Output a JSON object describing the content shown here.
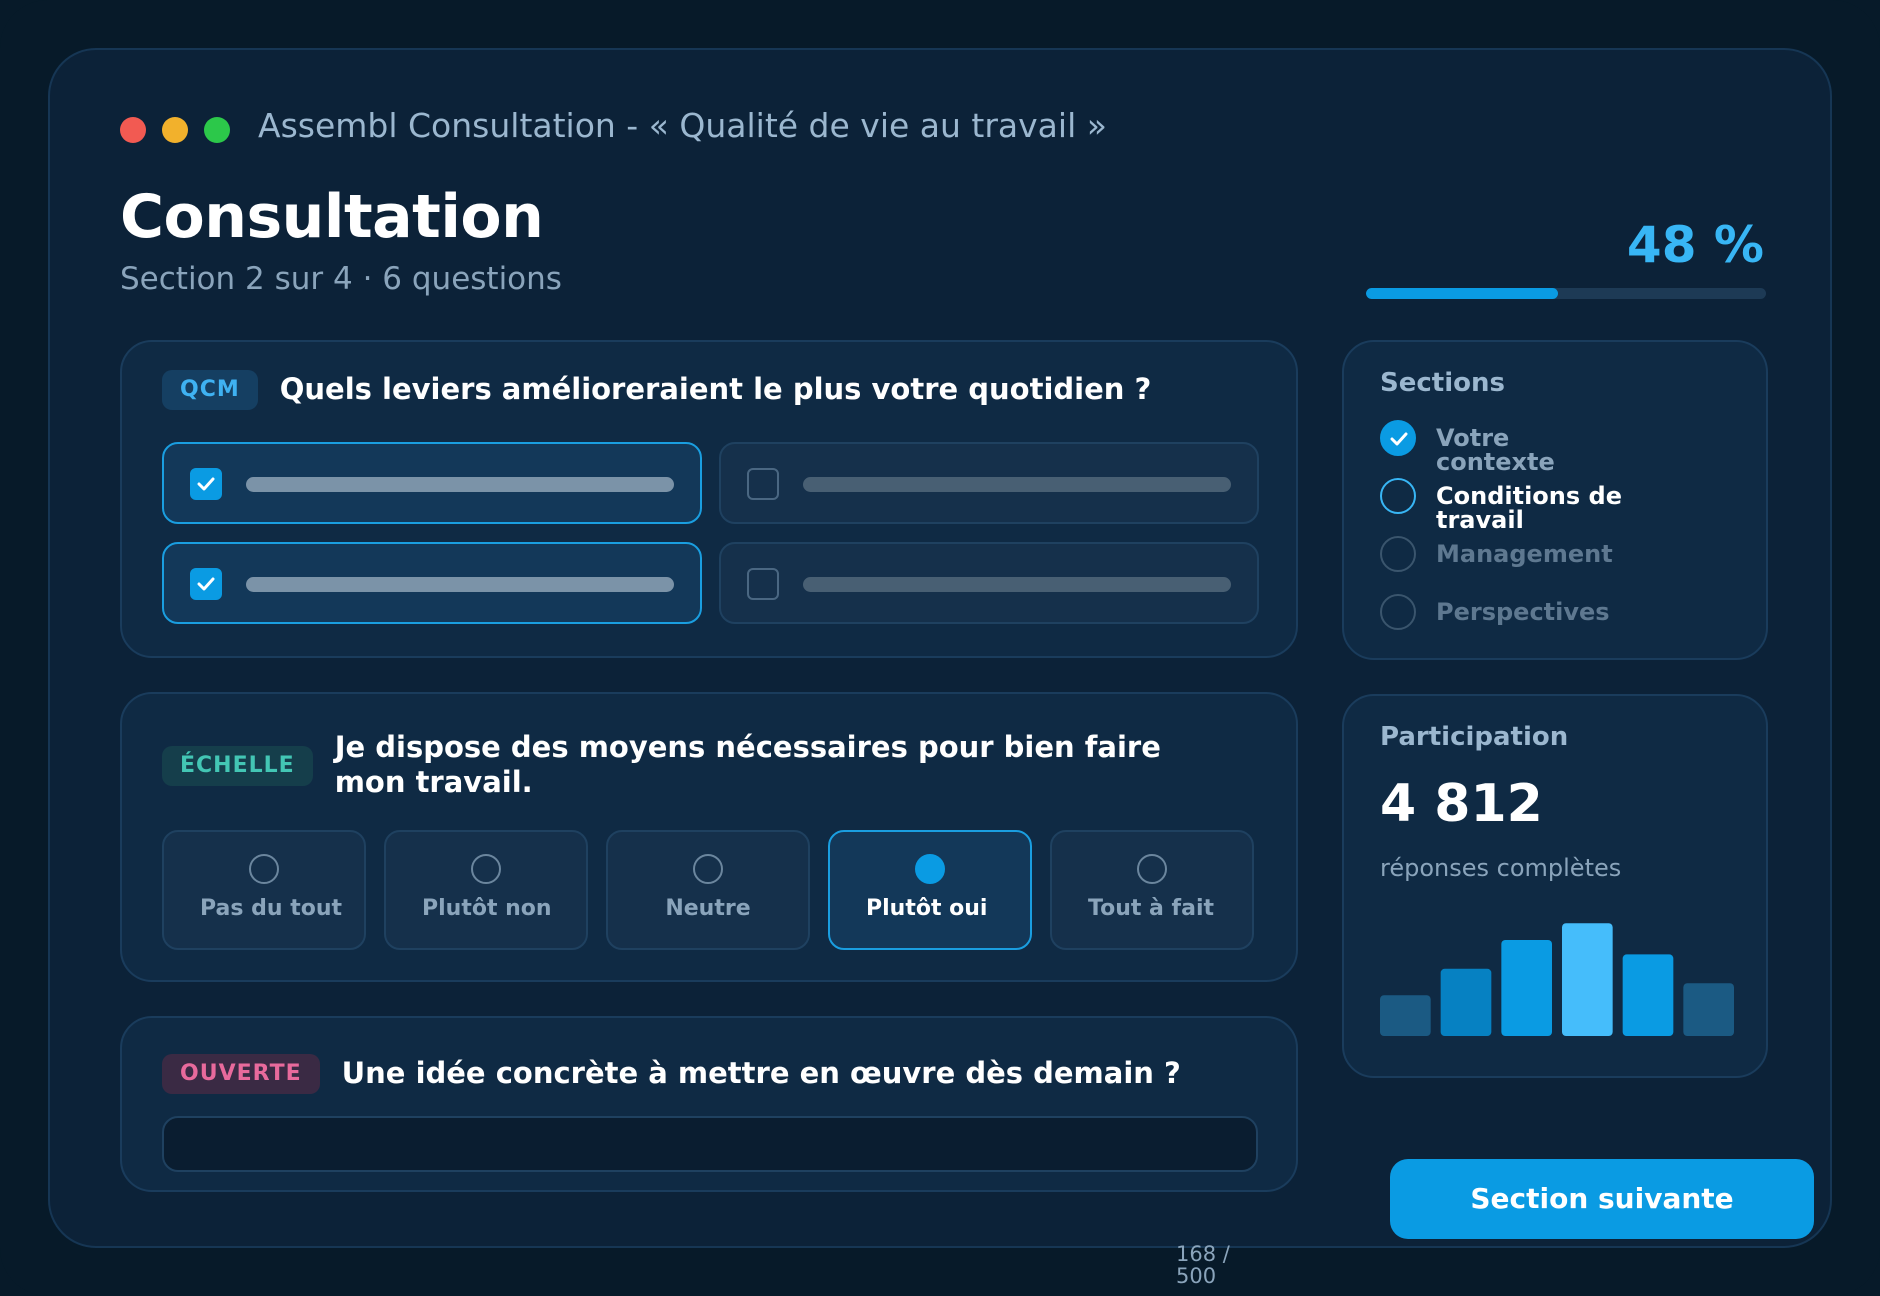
{
  "window": {
    "app_title": "Assembl Consultation - « Qualité de vie au travail »"
  },
  "header": {
    "title": "Consultation",
    "subtitle": "Section 2 sur 4 · 6 questions",
    "progress_label": "48 %",
    "progress_value": 0.48
  },
  "questions": [
    {
      "tag": "QCM",
      "text": "Quels leviers amélioreraient le plus votre quotidien ?",
      "options_checked": [
        true,
        false,
        true,
        false
      ]
    },
    {
      "tag": "ÉCHELLE",
      "text": "Je dispose des moyens nécessaires pour bien faire mon travail.",
      "options": [
        "Pas du tout",
        "Plutôt non",
        "Neutre",
        "Plutôt oui",
        "Tout à fait"
      ],
      "selected": "Plutôt oui"
    },
    {
      "tag": "OUVERTE",
      "text": "Une idée concrète à mettre en œuvre dès demain ?",
      "counter": "168 / 500",
      "value": ""
    }
  ],
  "sections": {
    "title": "Sections",
    "items": [
      {
        "label": "Votre contexte",
        "status": "done"
      },
      {
        "label": "Conditions de travail",
        "status": "current"
      },
      {
        "label": "Management",
        "status": "todo"
      },
      {
        "label": "Perspectives",
        "status": "todo"
      }
    ]
  },
  "participation": {
    "title": "Participation",
    "count": "4 812",
    "caption": "réponses complètes"
  },
  "chart_data": {
    "type": "bar",
    "values": [
      34,
      56,
      80,
      94,
      68,
      44
    ],
    "colors": [
      "#1b5a83",
      "#0681c2",
      "#0a9be3",
      "#45bdfb",
      "#0a9be3",
      "#1b5a83"
    ]
  },
  "footer": {
    "next_label": "Section suivante"
  },
  "colors": {
    "accent": "#0a9be3",
    "background": "#071a29",
    "card": "#0f2a44"
  }
}
